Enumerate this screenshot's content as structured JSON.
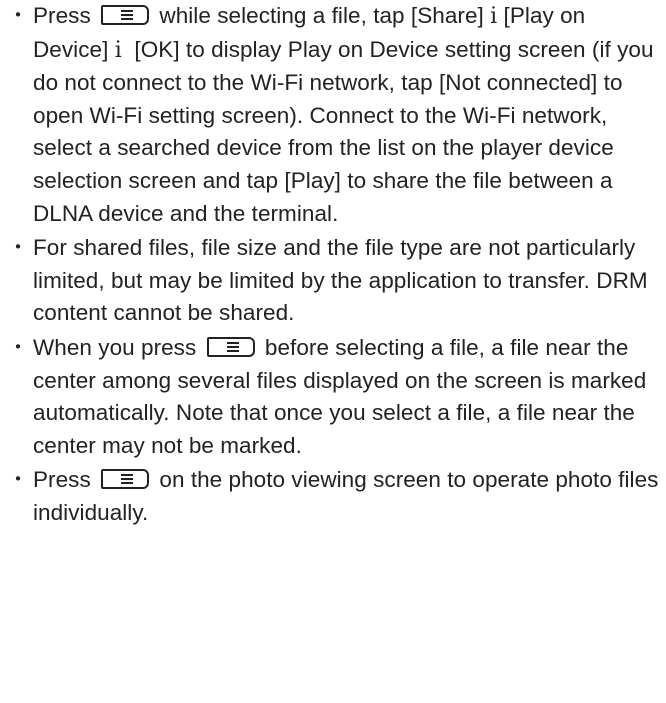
{
  "bullet_glyph": "・",
  "arrow_glyph": "i",
  "menu_key_icon": "menu-key-icon",
  "notes": [
    {
      "t1": "Press",
      "t2": "while selecting a file, tap [Share]",
      "t3": "[Play on Device]",
      "t4": "[OK] to display Play on Device setting screen (if you do not connect to the Wi-Fi network, tap [Not connected] to open Wi-Fi setting screen). Connect to the Wi-Fi network, select a searched device from the list on the player device selection screen and tap [Play] to share the file between a DLNA device and the terminal."
    },
    {
      "t1": "For shared files, file size and the file type are not particularly limited, but may be limited by the application to transfer. DRM content cannot be shared."
    },
    {
      "t1": "When you press",
      "t2": "before selecting a file, a file near the center among several files displayed on the screen is marked automatically. Note that once you select a file, a file near the center may not be marked."
    },
    {
      "t1": "Press",
      "t2": "on the photo viewing screen to operate photo files individually."
    }
  ]
}
